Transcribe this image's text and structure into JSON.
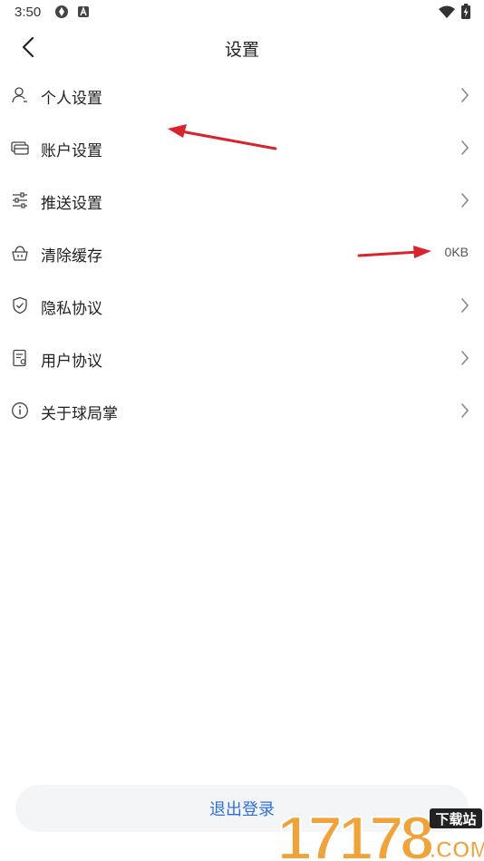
{
  "status_bar": {
    "time": "3:50",
    "icons": [
      "sync-icon",
      "app-notification-icon",
      "wifi-icon",
      "battery-charging-icon"
    ]
  },
  "header": {
    "title": "设置",
    "back_icon": "chevron-left-icon"
  },
  "settings": {
    "items": [
      {
        "label": "个人设置",
        "icon": "person-icon",
        "trailing": "chevron"
      },
      {
        "label": "账户设置",
        "icon": "card-icon",
        "trailing": "chevron"
      },
      {
        "label": "推送设置",
        "icon": "sliders-icon",
        "trailing": "chevron"
      },
      {
        "label": "清除缓存",
        "icon": "basket-icon",
        "trailing": "value",
        "value": "0KB"
      },
      {
        "label": "隐私协议",
        "icon": "shield-icon",
        "trailing": "chevron"
      },
      {
        "label": "用户协议",
        "icon": "document-icon",
        "trailing": "chevron"
      },
      {
        "label": "关于球局掌",
        "icon": "info-icon",
        "trailing": "chevron"
      }
    ]
  },
  "footer": {
    "logout_label": "退出登录"
  },
  "watermark": {
    "text": "17178",
    "badge": "下载站",
    "suffix": ".COM"
  },
  "colors": {
    "accent": "#2f6fe0",
    "annotation_arrow": "#d9232d",
    "watermark_orange": "#f0a33a",
    "button_bg": "#f4f5f7"
  }
}
